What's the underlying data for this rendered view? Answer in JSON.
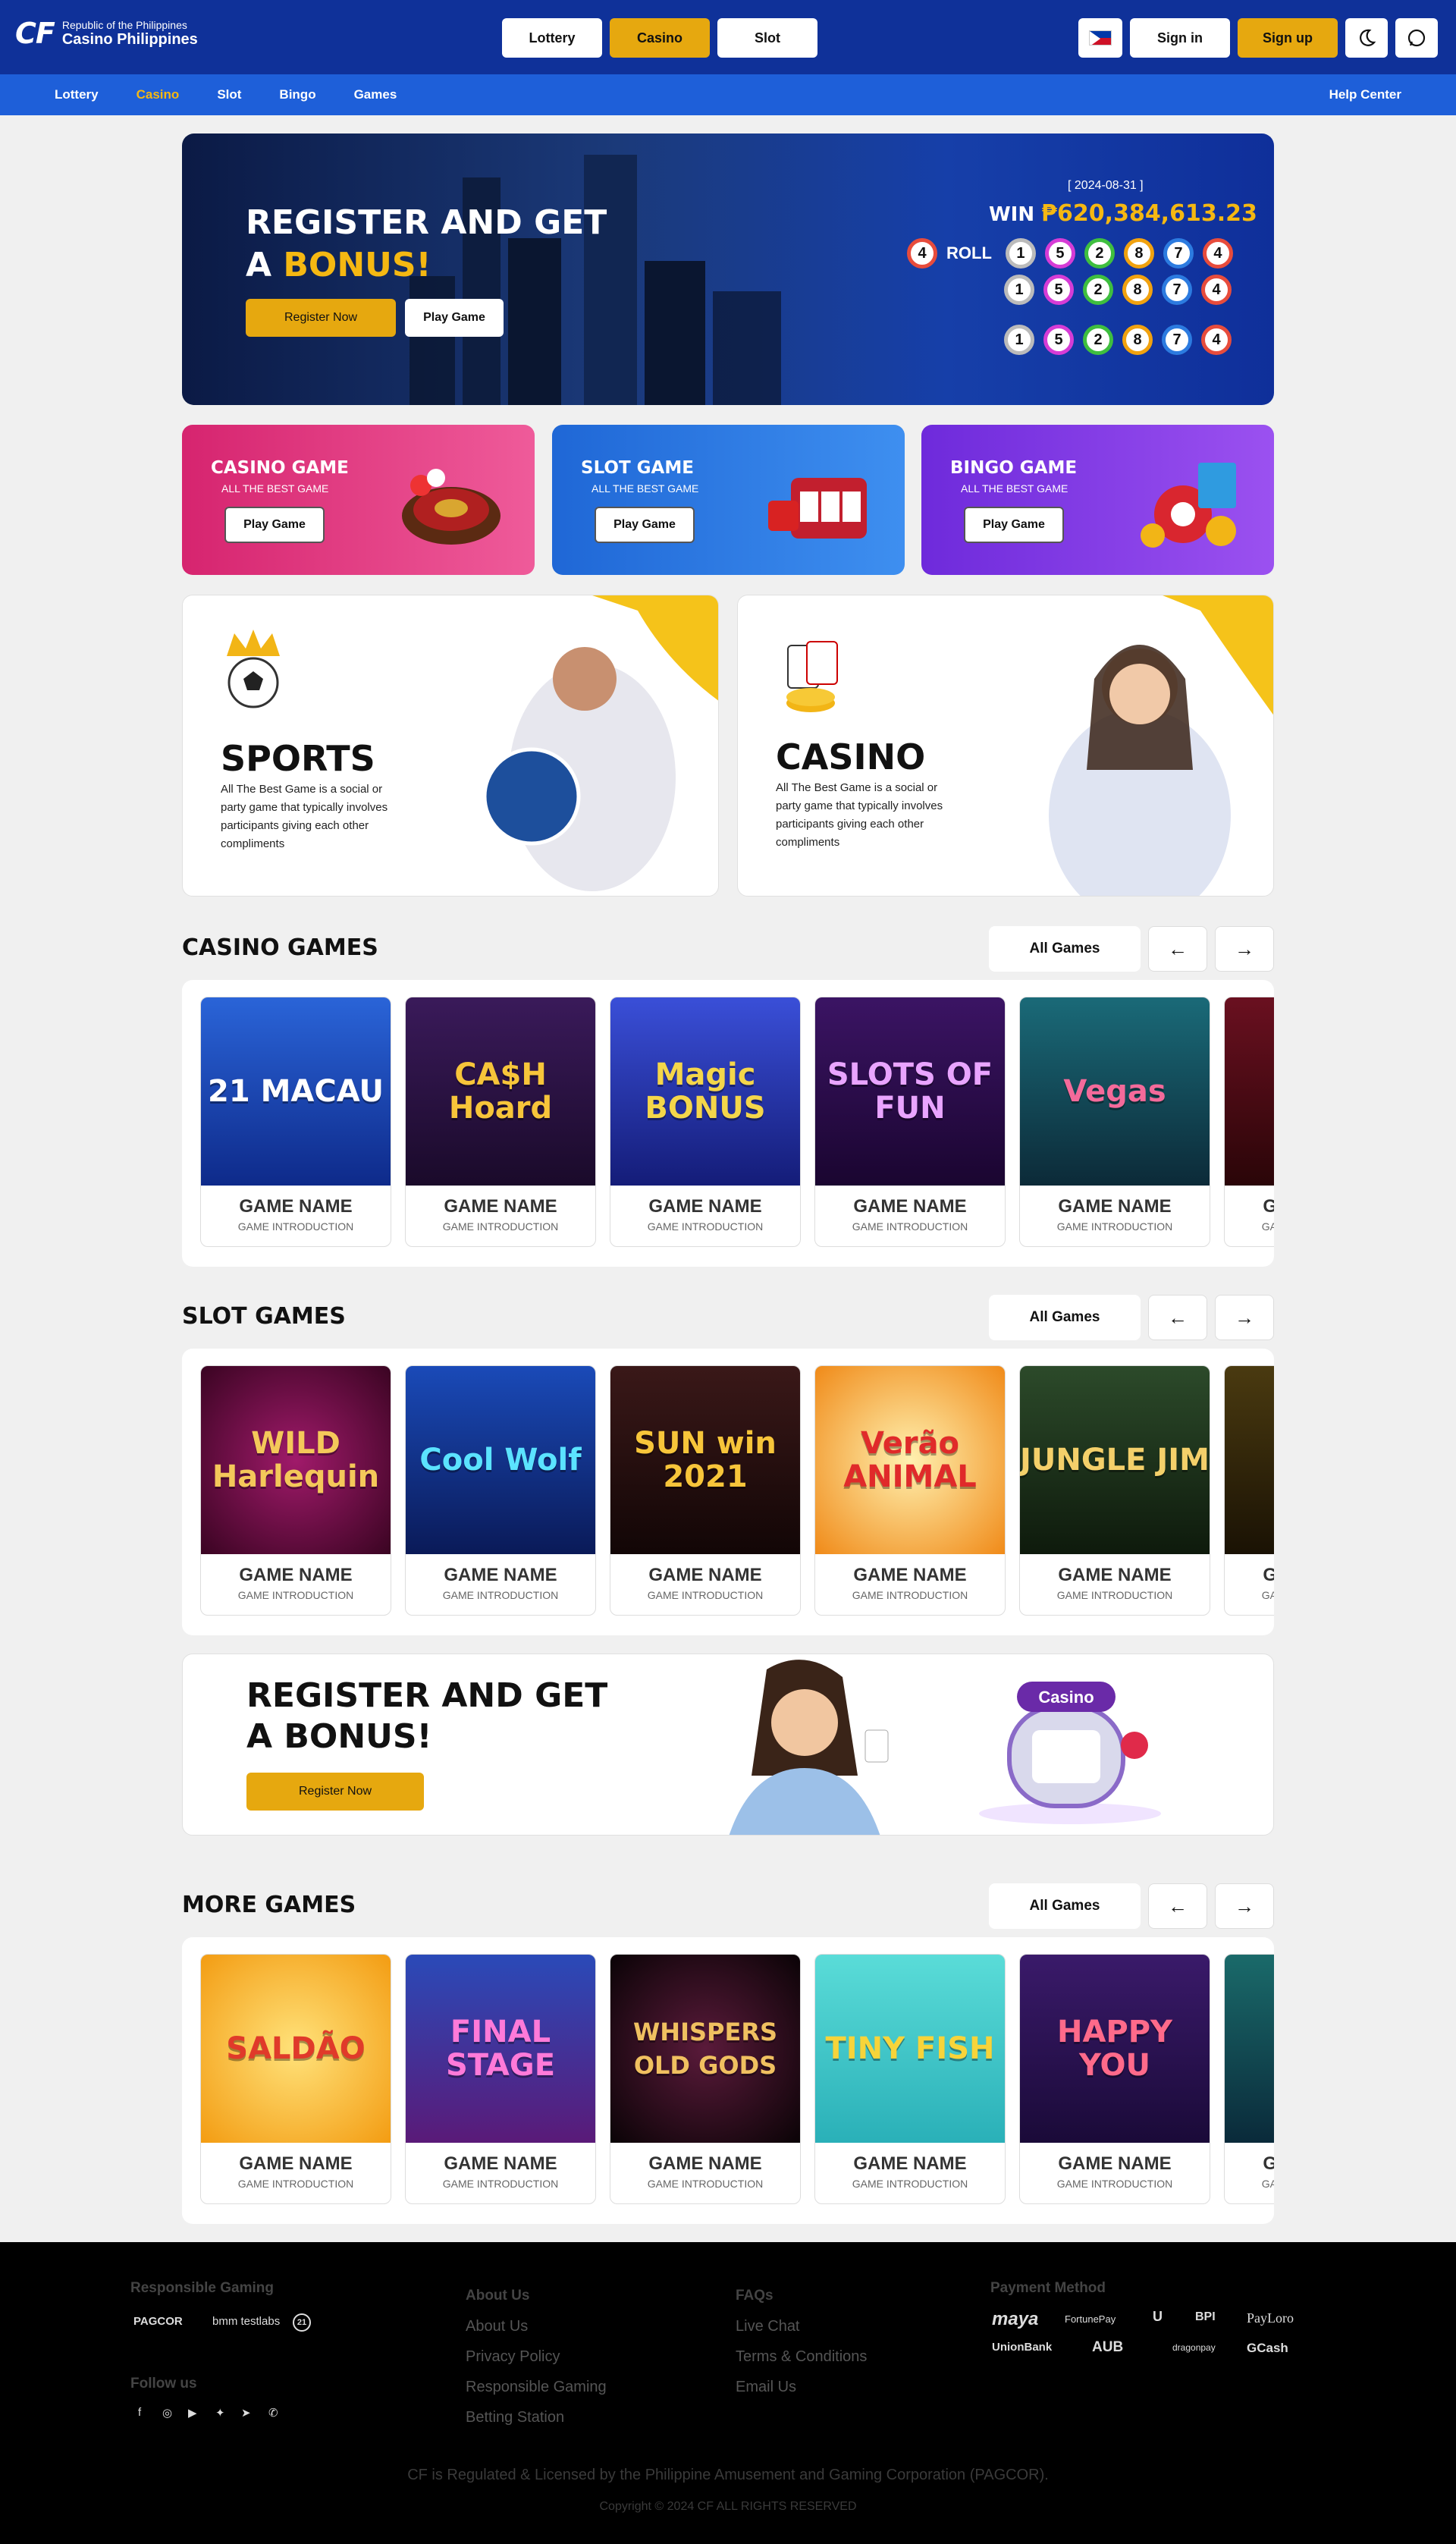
{
  "header": {
    "logo_mark": "CF",
    "logo_line1": "Republic of the Philippines",
    "logo_line2": "Casino Philippines",
    "tabs": [
      "Lottery",
      "Casino",
      "Slot"
    ],
    "active_tab": "Casino",
    "sign_in": "Sign in",
    "sign_up": "Sign up",
    "theme_icon": "moon-icon",
    "chat_icon": "whatsapp-icon"
  },
  "subnav": {
    "items": [
      "Lottery",
      "Casino",
      "Slot",
      "Bingo",
      "Games"
    ],
    "active": "Casino",
    "help": "Help Center"
  },
  "hero": {
    "title_line1": "REGISTER AND GET",
    "title_a": "A ",
    "title_bonus": "BONUS!",
    "register_btn": "Register Now",
    "play_btn": "Play Game",
    "date": "[ 2024-08-31 ]",
    "win_label": "WIN ",
    "win_amount": "₱620,384,613.23",
    "roll_label": "ROLL",
    "roll_count": "4",
    "rows": [
      [
        "1",
        "5",
        "2",
        "8",
        "7",
        "4"
      ],
      [
        "1",
        "5",
        "2",
        "8",
        "7",
        "4"
      ],
      [
        "1",
        "5",
        "2",
        "8",
        "7",
        "4"
      ]
    ]
  },
  "categories": [
    {
      "title": "CASINO GAME",
      "subtitle": "ALL THE BEST GAME",
      "button": "Play Game",
      "color": "#e0337f"
    },
    {
      "title": "SLOT GAME",
      "subtitle": "ALL THE BEST GAME",
      "button": "Play Game",
      "color": "#2877e0"
    },
    {
      "title": "BINGO GAME",
      "subtitle": "ALL THE BEST GAME",
      "button": "Play Game",
      "color": "#7a36e0"
    }
  ],
  "features": [
    {
      "title": "SPORTS",
      "desc": "All The Best Game is a social or party game that typically involves participants giving each other compliments"
    },
    {
      "title": "CASINO",
      "desc": "All The Best Game is a social or party game that typically involves participants giving each other compliments"
    }
  ],
  "sections": {
    "all_games": "All Games",
    "casino": {
      "title": "CASINO GAMES",
      "games": [
        {
          "art": "21 MACAU",
          "name": "GAME NAME",
          "intro": "GAME INTRODUCTION"
        },
        {
          "art": "CA$H Hoard",
          "name": "GAME NAME",
          "intro": "GAME INTRODUCTION"
        },
        {
          "art": "Magic BONUS",
          "name": "GAME NAME",
          "intro": "GAME INTRODUCTION"
        },
        {
          "art": "SLOTS OF FUN",
          "name": "GAME NAME",
          "intro": "GAME INTRODUCTION"
        },
        {
          "art": "Vegas",
          "name": "GAME NAME",
          "intro": "GAME INTRODUCTION"
        },
        {
          "art": "",
          "name": "GAME NAME",
          "intro": "GAME INTRODUCTION"
        }
      ]
    },
    "slot": {
      "title": "SLOT GAMES",
      "games": [
        {
          "art": "WILD Harlequin",
          "name": "GAME NAME",
          "intro": "GAME INTRODUCTION"
        },
        {
          "art": "Cool Wolf",
          "name": "GAME NAME",
          "intro": "GAME INTRODUCTION"
        },
        {
          "art": "SUN win 2021",
          "name": "GAME NAME",
          "intro": "GAME INTRODUCTION"
        },
        {
          "art": "Verão ANIMAL",
          "name": "GAME NAME",
          "intro": "GAME INTRODUCTION"
        },
        {
          "art": "JUNGLE JIM",
          "name": "GAME NAME",
          "intro": "GAME INTRODUCTION"
        },
        {
          "art": "",
          "name": "GAME NAME",
          "intro": "GAME INTRODUCTION"
        }
      ]
    },
    "more": {
      "title": "MORE GAMES",
      "games": [
        {
          "art": "SALDÃO",
          "name": "GAME NAME",
          "intro": "GAME INTRODUCTION"
        },
        {
          "art": "FINAL STAGE",
          "name": "GAME NAME",
          "intro": "GAME INTRODUCTION"
        },
        {
          "art": "WHISPERS OLD GODS",
          "name": "GAME NAME",
          "intro": "GAME INTRODUCTION"
        },
        {
          "art": "TINY FISH",
          "name": "GAME NAME",
          "intro": "GAME INTRODUCTION"
        },
        {
          "art": "HAPPY YOU",
          "name": "GAME NAME",
          "intro": "GAME INTRODUCTION"
        },
        {
          "art": "",
          "name": "GAME NAME",
          "intro": "GAME INTRODUCTION"
        }
      ]
    }
  },
  "banner": {
    "line1": "REGISTER AND GET",
    "line2": "A BONUS!",
    "button": "Register Now",
    "sign_text": "Casino"
  },
  "footer": {
    "responsible_title": "Responsible Gaming",
    "partners": [
      "PAGCOR",
      "bmm testlabs",
      "21"
    ],
    "follow_title": "Follow us",
    "social_icons": [
      "facebook-icon",
      "instagram-icon",
      "youtube-icon",
      "twitter-icon",
      "telegram-icon",
      "whatsapp-icon"
    ],
    "about_title": "About Us",
    "about_links": [
      "About Us",
      "Privacy Policy",
      "Responsible Gaming",
      "Betting Station"
    ],
    "faq_title": "FAQs",
    "faq_links": [
      "Live Chat",
      "Terms & Conditions",
      "Email Us"
    ],
    "payment_title": "Payment Method",
    "payments_row1": [
      "maya",
      "FortunePay",
      "U",
      "BPI",
      "PayLoro"
    ],
    "payments_row2": [
      "UnionBank",
      "AUB",
      "dragonpay",
      "GCash"
    ],
    "regulated": "CF is  Regulated & Licensed by the Philippine Amusement and Gaming Corporation (PAGCOR).",
    "copyright": "Copyright © 2024 CF ALL RIGHTS RESERVED"
  }
}
